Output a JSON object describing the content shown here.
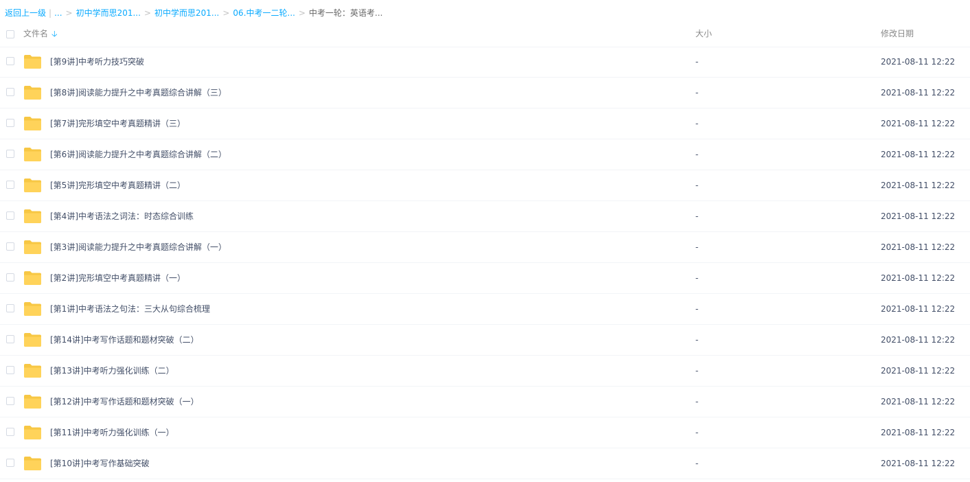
{
  "breadcrumb": {
    "back_label": "返回上一级",
    "ellipsis": "...",
    "items": [
      "初中学而思201...",
      "初中学而思201...",
      "06.中考一二轮..."
    ],
    "current": "中考一轮：英语考..."
  },
  "table": {
    "columns": {
      "name": "文件名",
      "size": "大小",
      "date": "修改日期"
    },
    "sort_icon": "arrow-down-icon",
    "folder_icon": "folder-icon",
    "folder_color": "#FFD35A",
    "rows": [
      {
        "name": "[第9讲]中考听力技巧突破",
        "size": "-",
        "date": "2021-08-11 12:22"
      },
      {
        "name": "[第8讲]阅读能力提升之中考真题综合讲解（三）",
        "size": "-",
        "date": "2021-08-11 12:22"
      },
      {
        "name": "[第7讲]完形填空中考真题精讲（三）",
        "size": "-",
        "date": "2021-08-11 12:22"
      },
      {
        "name": "[第6讲]阅读能力提升之中考真题综合讲解（二）",
        "size": "-",
        "date": "2021-08-11 12:22"
      },
      {
        "name": "[第5讲]完形填空中考真题精讲（二）",
        "size": "-",
        "date": "2021-08-11 12:22"
      },
      {
        "name": "[第4讲]中考语法之词法：时态综合训练",
        "size": "-",
        "date": "2021-08-11 12:22"
      },
      {
        "name": "[第3讲]阅读能力提升之中考真题综合讲解（一）",
        "size": "-",
        "date": "2021-08-11 12:22"
      },
      {
        "name": "[第2讲]完形填空中考真题精讲（一）",
        "size": "-",
        "date": "2021-08-11 12:22"
      },
      {
        "name": "[第1讲]中考语法之句法：三大从句综合梳理",
        "size": "-",
        "date": "2021-08-11 12:22"
      },
      {
        "name": "[第14讲]中考写作话题和题材突破（二）",
        "size": "-",
        "date": "2021-08-11 12:22"
      },
      {
        "name": "[第13讲]中考听力强化训练（二）",
        "size": "-",
        "date": "2021-08-11 12:22"
      },
      {
        "name": "[第12讲]中考写作话题和题材突破（一）",
        "size": "-",
        "date": "2021-08-11 12:22"
      },
      {
        "name": "[第11讲]中考听力强化训练（一）",
        "size": "-",
        "date": "2021-08-11 12:22"
      },
      {
        "name": "[第10讲]中考写作基础突破",
        "size": "-",
        "date": "2021-08-11 12:22"
      }
    ]
  }
}
